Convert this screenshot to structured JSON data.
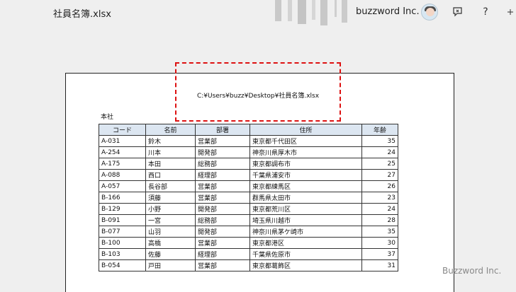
{
  "titlebar": {
    "file_title": "社員名簿.xlsx",
    "account_name": "buzzword Inc."
  },
  "icons": {
    "avatar": "user-avatar",
    "feedback": "feedback-icon",
    "help": "help-icon",
    "help_glyph": "?"
  },
  "page": {
    "header_path": "C:¥Users¥buzz¥Desktop¥社員名簿.xlsx",
    "section_label": "本社",
    "columns": [
      "コード",
      "名前",
      "部署",
      "住所",
      "年齢"
    ],
    "rows": [
      [
        "A-031",
        "鈴木",
        "営業部",
        "東京都千代田区",
        "35"
      ],
      [
        "A-254",
        "川本",
        "開発部",
        "神奈川県厚木市",
        "24"
      ],
      [
        "A-175",
        "本田",
        "総務部",
        "東京都調布市",
        "25"
      ],
      [
        "A-088",
        "西口",
        "経理部",
        "千葉県浦安市",
        "27"
      ],
      [
        "A-057",
        "長谷部",
        "営業部",
        "東京都練馬区",
        "26"
      ],
      [
        "B-166",
        "須藤",
        "営業部",
        "群馬県太田市",
        "23"
      ],
      [
        "B-129",
        "小野",
        "開発部",
        "東京都荒川区",
        "24"
      ],
      [
        "B-091",
        "一宮",
        "総務部",
        "埼玉県川越市",
        "28"
      ],
      [
        "B-077",
        "山羽",
        "開発部",
        "神奈川県茅ケ崎市",
        "35"
      ],
      [
        "B-100",
        "高橋",
        "営業部",
        "東京都港区",
        "30"
      ],
      [
        "B-103",
        "佐藤",
        "経理部",
        "千葉県佐原市",
        "37"
      ],
      [
        "B-054",
        "戸田",
        "営業部",
        "東京都葛飾区",
        "31"
      ]
    ]
  },
  "watermark": "Buzzword Inc.",
  "colors": {
    "header_fill": "#dce6f1",
    "highlight_border": "#dd1111"
  }
}
